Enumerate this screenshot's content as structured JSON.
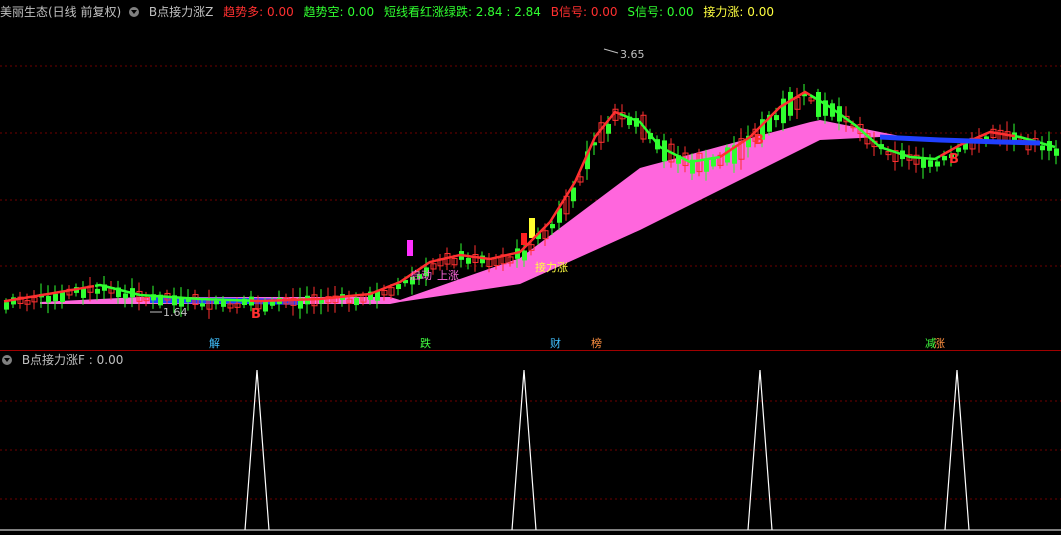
{
  "top": {
    "title": "美丽生态(日线 前复权)",
    "indicator": "B点接力涨Z",
    "items": [
      {
        "label": "趋势多: 0.00",
        "color": "#ff3030"
      },
      {
        "label": "趋势空: 0.00",
        "color": "#30ff30"
      },
      {
        "label": "短线看红涨绿跌: 2.84 : 2.84",
        "color": "#30ff30"
      },
      {
        "label": "B信号: 0.00",
        "color": "#ff3030"
      },
      {
        "label": "S信号: 0.00",
        "color": "#30ff30"
      },
      {
        "label": "接力涨: 0.00",
        "color": "#ffff40"
      }
    ]
  },
  "annotations": {
    "high_label": "3.65",
    "low_label": "1.64",
    "qidong": "启动",
    "shangzhang": "上涨",
    "jieli": "接力涨",
    "b_marks": [
      "B",
      "B",
      "B"
    ]
  },
  "tags": [
    {
      "text": "解",
      "color": "#40c0ff"
    },
    {
      "text": "跌",
      "color": "#40ff40"
    },
    {
      "text": "财",
      "color": "#40c0ff"
    },
    {
      "text": "榜",
      "color": "#ff9040"
    },
    {
      "text": "减",
      "color": "#40ff40"
    },
    {
      "text": "涨",
      "color": "#ff9040"
    }
  ],
  "bottom": {
    "label": "B点接力涨F : 0.00",
    "spike_values": [
      1,
      1,
      1,
      1
    ]
  },
  "colors": {
    "up": "#ff3030",
    "down": "#30ff30",
    "ma_pink": "#ff66dd",
    "grid": "#800000",
    "blue": "#2040ff"
  }
}
